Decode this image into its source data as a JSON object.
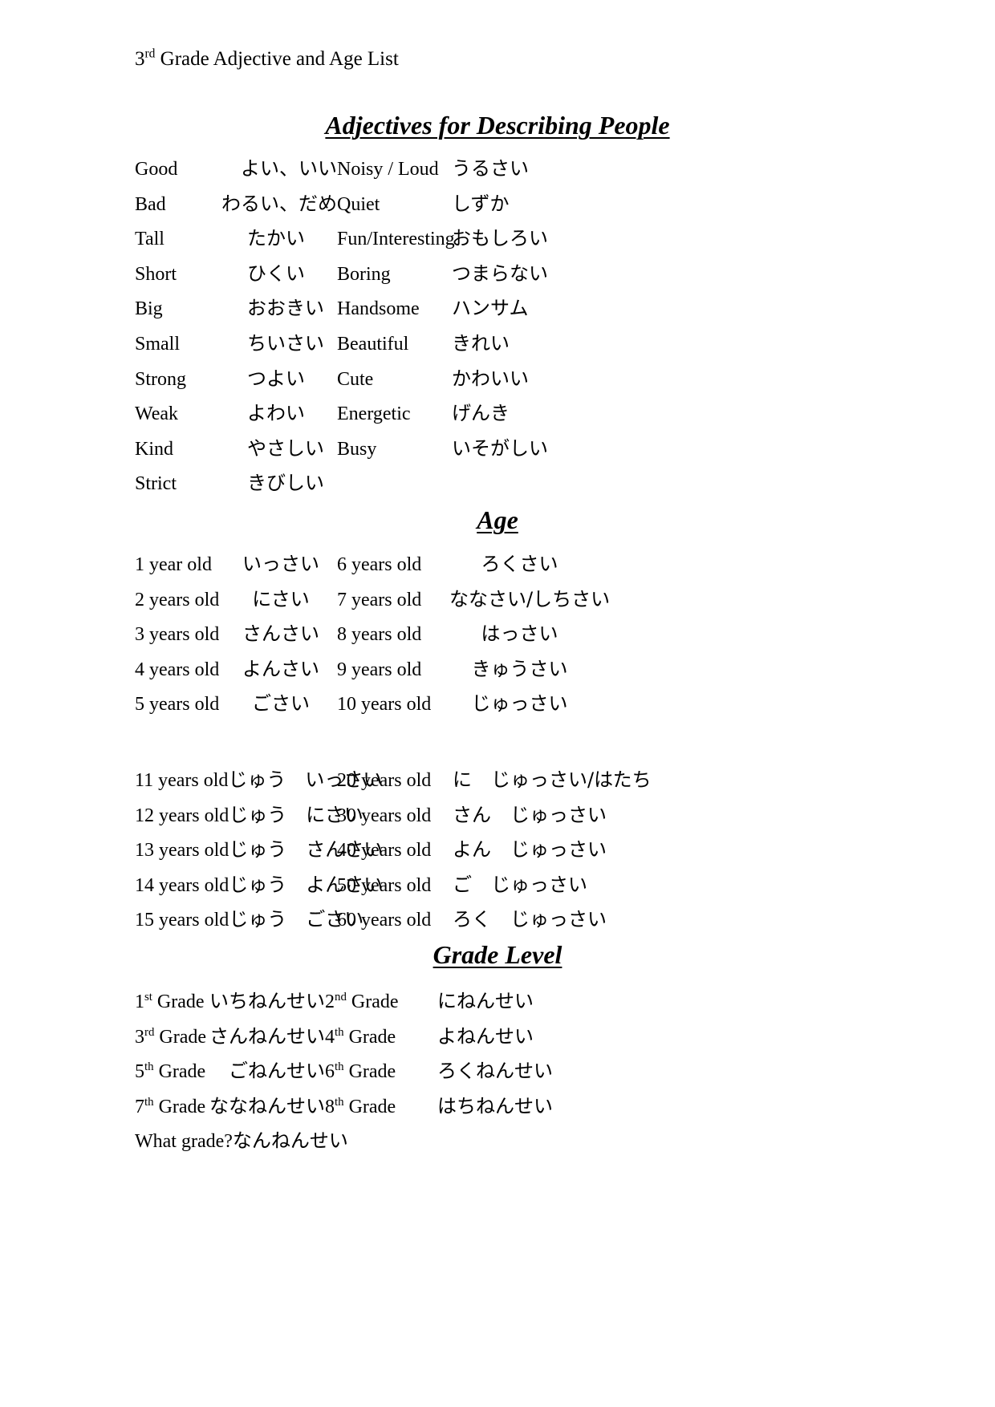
{
  "document": {
    "header": {
      "ordinal_number": "3",
      "ordinal_suffix": "rd",
      "rest": " Grade Adjective and Age List"
    }
  },
  "sections": {
    "adjectives": {
      "title": "Adjectives for Describing People",
      "left": [
        {
          "en": "Good",
          "jp": "よい、いい"
        },
        {
          "en": "Bad",
          "jp": "わるい、だめ"
        },
        {
          "en": "Tall",
          "jp": "たかい"
        },
        {
          "en": "Short",
          "jp": "ひくい"
        },
        {
          "en": "Big",
          "jp": "おおきい"
        },
        {
          "en": "Small",
          "jp": "ちいさい"
        },
        {
          "en": "Strong",
          "jp": "つよい"
        },
        {
          "en": "Weak",
          "jp": "よわい"
        },
        {
          "en": "Kind",
          "jp": "やさしい"
        },
        {
          "en": "Strict",
          "jp": "きびしい"
        }
      ],
      "right": [
        {
          "en": "Noisy / Loud",
          "jp": "うるさい"
        },
        {
          "en": "Quiet",
          "jp": "しずか"
        },
        {
          "en": "Fun/Interesting",
          "jp": "おもしろい"
        },
        {
          "en": "Boring",
          "jp": "つまらない"
        },
        {
          "en": "Handsome",
          "jp": "ハンサム"
        },
        {
          "en": "Beautiful",
          "jp": "きれい"
        },
        {
          "en": "Cute",
          "jp": "かわいい"
        },
        {
          "en": "Energetic",
          "jp": "げんき"
        },
        {
          "en": "Busy",
          "jp": "いそがしい"
        },
        {
          "en": "",
          "jp": ""
        }
      ]
    },
    "age": {
      "title": "Age",
      "group1_left": [
        {
          "en": "1 year old",
          "jp": "いっさい"
        },
        {
          "en": "2 years old",
          "jp": "にさい"
        },
        {
          "en": "3 years old",
          "jp": "さんさい"
        },
        {
          "en": "4 years old",
          "jp": "よんさい"
        },
        {
          "en": "5 years old",
          "jp": "ごさい"
        }
      ],
      "group1_right": [
        {
          "en": "6 years old",
          "jp": "ろくさい"
        },
        {
          "en": "7 years old",
          "jp": "ななさい/しちさい"
        },
        {
          "en": "8 years old",
          "jp": "はっさい"
        },
        {
          "en": "9 years old",
          "jp": "きゅうさい"
        },
        {
          "en": "10 years old",
          "jp": "じゅっさい"
        }
      ],
      "group2_left": [
        {
          "en": "11 years old",
          "jp": "じゅう　いっさい"
        },
        {
          "en": "12 years old",
          "jp": "じゅう　にさい"
        },
        {
          "en": "13 years old",
          "jp": "じゅう　さんさい"
        },
        {
          "en": "14 years old",
          "jp": "じゅう　よんさい"
        },
        {
          "en": "15 years old",
          "jp": "じゅう　ごさい"
        }
      ],
      "group2_right": [
        {
          "en": "20 years old",
          "jp": "に　じゅっさい/はたち"
        },
        {
          "en": "30 years old",
          "jp": "さん　じゅっさい"
        },
        {
          "en": "40 years old",
          "jp": "よん　じゅっさい"
        },
        {
          "en": "50 years old",
          "jp": "ご　じゅっさい"
        },
        {
          "en": "60 years old",
          "jp": "ろく　じゅっさい"
        }
      ]
    },
    "grade": {
      "title": "Grade Level",
      "left": [
        {
          "num": "1",
          "sup": "st",
          "label": " Grade",
          "jp": "いちねんせい"
        },
        {
          "num": "3",
          "sup": "rd",
          "label": " Grade",
          "jp": "さんねんせい"
        },
        {
          "num": "5",
          "sup": "th",
          "label": " Grade",
          "jp": "ごねんせい"
        },
        {
          "num": "7",
          "sup": "th",
          "label": " Grade",
          "jp": "ななねんせい"
        },
        {
          "num": "What grade?",
          "sup": "",
          "label": "",
          "jp": "なんねんせい"
        }
      ],
      "right": [
        {
          "num": "2",
          "sup": "nd",
          "label": " Grade",
          "jp": "にねんせい"
        },
        {
          "num": "4",
          "sup": "th",
          "label": " Grade",
          "jp": "よねんせい"
        },
        {
          "num": "6",
          "sup": "th",
          "label": " Grade",
          "jp": "ろくねんせい"
        },
        {
          "num": "8",
          "sup": "th",
          "label": " Grade",
          "jp": "はちねんせい"
        },
        {
          "num": "",
          "sup": "",
          "label": "",
          "jp": ""
        }
      ]
    }
  }
}
